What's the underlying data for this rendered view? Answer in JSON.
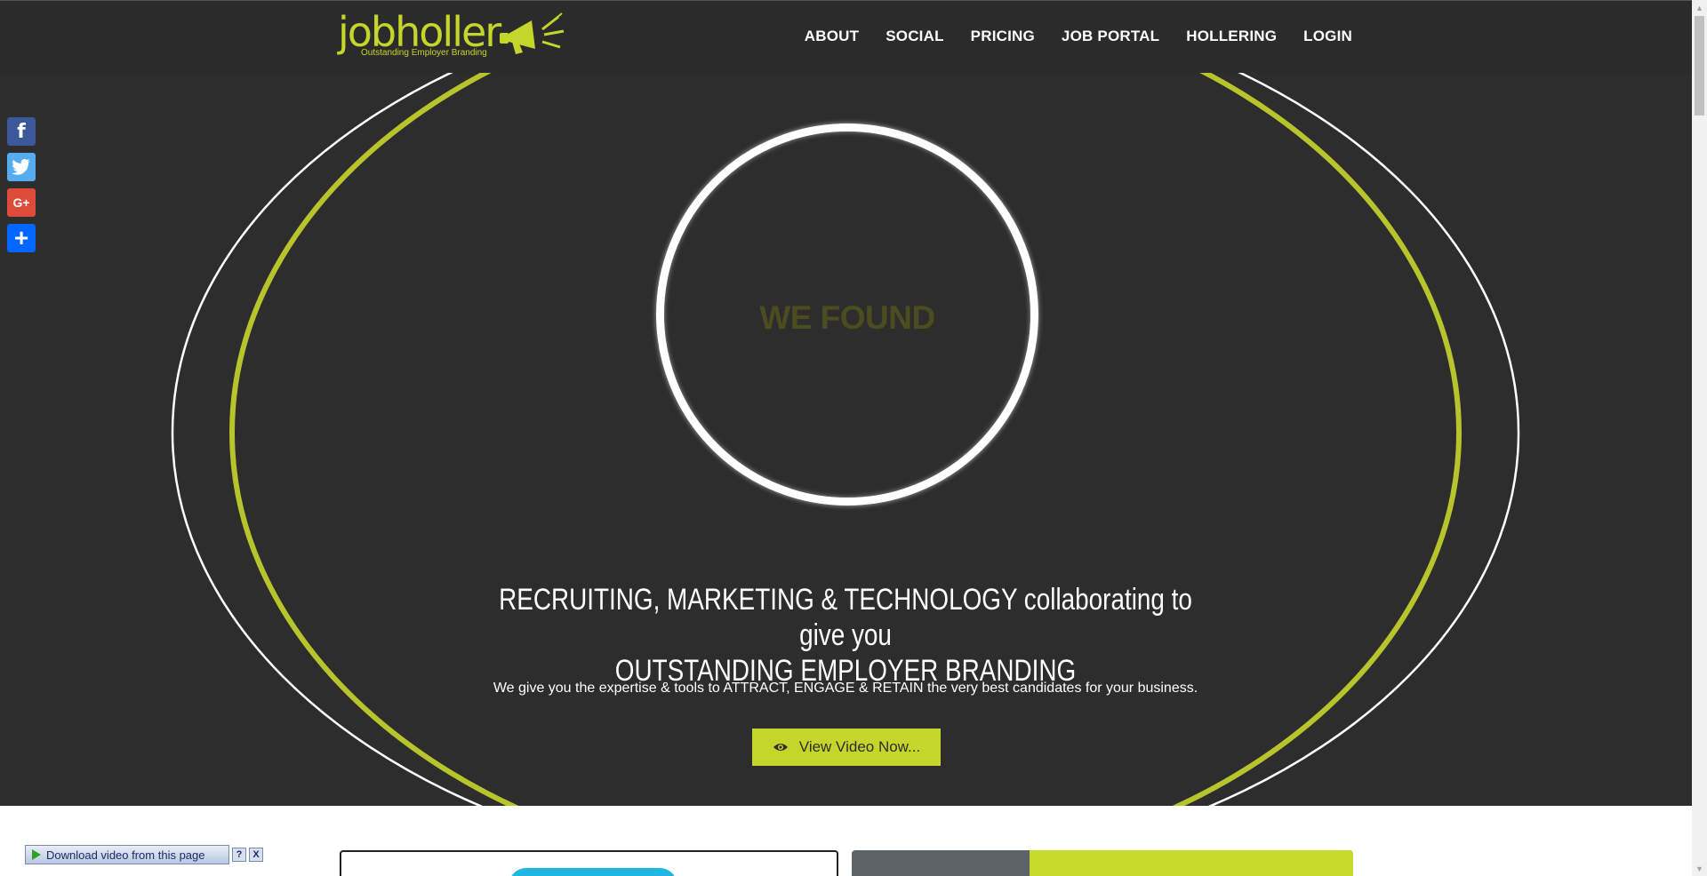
{
  "brand": {
    "name_bold": "job",
    "name_thin": "holler",
    "tagline": "Outstanding Employer Branding"
  },
  "nav": {
    "items": [
      "ABOUT",
      "SOCIAL",
      "PRICING",
      "JOB PORTAL",
      "HOLLERING",
      "LOGIN"
    ]
  },
  "social": {
    "facebook": "f",
    "google": "G+",
    "share": "+"
  },
  "hero": {
    "ring_text": "WE FOUND",
    "headline_line1": "RECRUITING, MARKETING & TECHNOLOGY collaborating to give you",
    "headline_line2": "OUTSTANDING EMPLOYER BRANDING",
    "subline": "We give you the expertise & tools to ATTRACT, ENGAGE & RETAIN the very best candidates for your business.",
    "cta_label": "View Video Now..."
  },
  "download_bar": {
    "label": "Download video from this page",
    "help": "?",
    "close": "X"
  },
  "colors": {
    "accent": "#c5d62b",
    "dark_bg": "#2d2d2d",
    "header_bg": "#2b2b2b",
    "facebook": "#3b5998",
    "twitter": "#55acee",
    "google": "#dd4b39",
    "share": "#0166ff"
  }
}
